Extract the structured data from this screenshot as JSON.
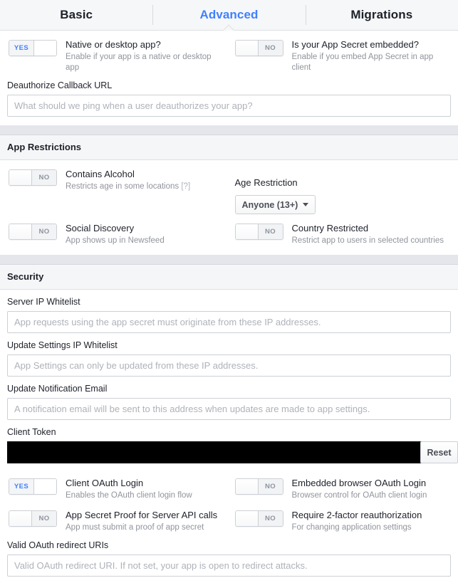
{
  "tabs": [
    {
      "label": "Basic",
      "active": false
    },
    {
      "label": "Advanced",
      "active": true
    },
    {
      "label": "Migrations",
      "active": false
    }
  ],
  "top_toggles": [
    {
      "state": "YES",
      "title": "Native or desktop app?",
      "subtitle": "Enable if your app is a native or desktop app"
    },
    {
      "state": "NO",
      "title": "Is your App Secret embedded?",
      "subtitle": "Enable if you embed App Secret in app client"
    }
  ],
  "deauthorize": {
    "label": "Deauthorize Callback URL",
    "placeholder": "What should we ping when a user deauthorizes your app?",
    "value": ""
  },
  "app_restrictions": {
    "header": "App Restrictions",
    "alcohol": {
      "state": "NO",
      "title": "Contains Alcohol",
      "subtitle": "Restricts age in some locations",
      "help": "[?]"
    },
    "age": {
      "label": "Age Restriction",
      "selected": "Anyone (13+)"
    },
    "social_discovery": {
      "state": "NO",
      "title": "Social Discovery",
      "subtitle": "App shows up in Newsfeed"
    },
    "country_restricted": {
      "state": "NO",
      "title": "Country Restricted",
      "subtitle": "Restrict app to users in selected countries"
    }
  },
  "security": {
    "header": "Security",
    "server_ip": {
      "label": "Server IP Whitelist",
      "placeholder": "App requests using the app secret must originate from these IP addresses.",
      "value": ""
    },
    "update_ip": {
      "label": "Update Settings IP Whitelist",
      "placeholder": "App Settings can only be updated from these IP addresses.",
      "value": ""
    },
    "update_email": {
      "label": "Update Notification Email",
      "placeholder": "A notification email will be sent to this address when updates are made to app settings.",
      "value": ""
    },
    "client_token": {
      "label": "Client Token",
      "value": "",
      "redacted": true,
      "reset_label": "Reset"
    },
    "oauth_toggles": [
      {
        "state": "YES",
        "title": "Client OAuth Login",
        "subtitle": "Enables the OAuth client login flow"
      },
      {
        "state": "NO",
        "title": "Embedded browser OAuth Login",
        "subtitle": "Browser control for OAuth client login"
      },
      {
        "state": "NO",
        "title": "App Secret Proof for Server API calls",
        "subtitle": "App must submit a proof of app secret"
      },
      {
        "state": "NO",
        "title": "Require 2-factor reauthorization",
        "subtitle": "For changing application settings"
      }
    ],
    "redirect_uris": {
      "label": "Valid OAuth redirect URIs",
      "placeholder": "Valid OAuth redirect URI. If not set, your app is open to redirect attacks.",
      "value": ""
    }
  },
  "colors": {
    "accent": "#4080ff",
    "text": "#1d2129",
    "muted": "#90949c"
  }
}
